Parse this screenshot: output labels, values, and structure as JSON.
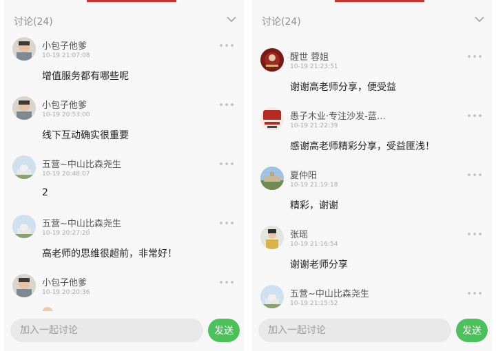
{
  "left": {
    "header_title": "讨论(24)",
    "comments": [
      {
        "user": "小包子他爹",
        "time": "10-19 21:07:08",
        "text": "增值服务都有哪些呢",
        "avatar": "child-photo-avatar"
      },
      {
        "user": "小包子他爹",
        "time": "10-19 20:53:00",
        "text": "线下互动确实很重要",
        "avatar": "child-photo-avatar"
      },
      {
        "user": "五营~中山比森尧生",
        "time": "10-19 20:48:07",
        "text": "2",
        "avatar": "capitol-building-avatar"
      },
      {
        "user": "五营~中山比森尧生",
        "time": "10-19 20:27:20",
        "text": "高老师的思维很超前，非常好！",
        "avatar": "capitol-building-avatar"
      },
      {
        "user": "小包子他爹",
        "time": "10-19 20:20:36",
        "text": "",
        "avatar": "child-photo-avatar"
      }
    ],
    "input_placeholder": "加入一起讨论",
    "send_label": "发送"
  },
  "right": {
    "header_title": "讨论(24)",
    "comments": [
      {
        "user": "醒世 蓉姐",
        "time": "10-19 21:23:51",
        "text": "谢谢高老师分享，便受益",
        "avatar": "red-logo-avatar"
      },
      {
        "user": "愚子木业·专注沙发-蓝…",
        "time": "10-19 21:22:39",
        "text": "感谢高老师精彩分享，受益匪浅！",
        "avatar": "brand-logo-avatar"
      },
      {
        "user": "夏仲阳",
        "time": "10-19 21:19:18",
        "text": "精彩，谢谢",
        "avatar": "landscape-avatar"
      },
      {
        "user": "张瑶",
        "time": "10-19 21:16:54",
        "text": "谢谢老师分享",
        "avatar": "person-photo-avatar"
      },
      {
        "user": "五营~中山比森尧生",
        "time": "10-19 21:15:52",
        "text": "",
        "avatar": "capitol-building-avatar"
      }
    ],
    "input_placeholder": "加入一起讨论",
    "send_label": "发送"
  },
  "colors": {
    "accent_green": "#4cc05b",
    "top_red": "#c8332b",
    "background": "#f7f7f7"
  }
}
